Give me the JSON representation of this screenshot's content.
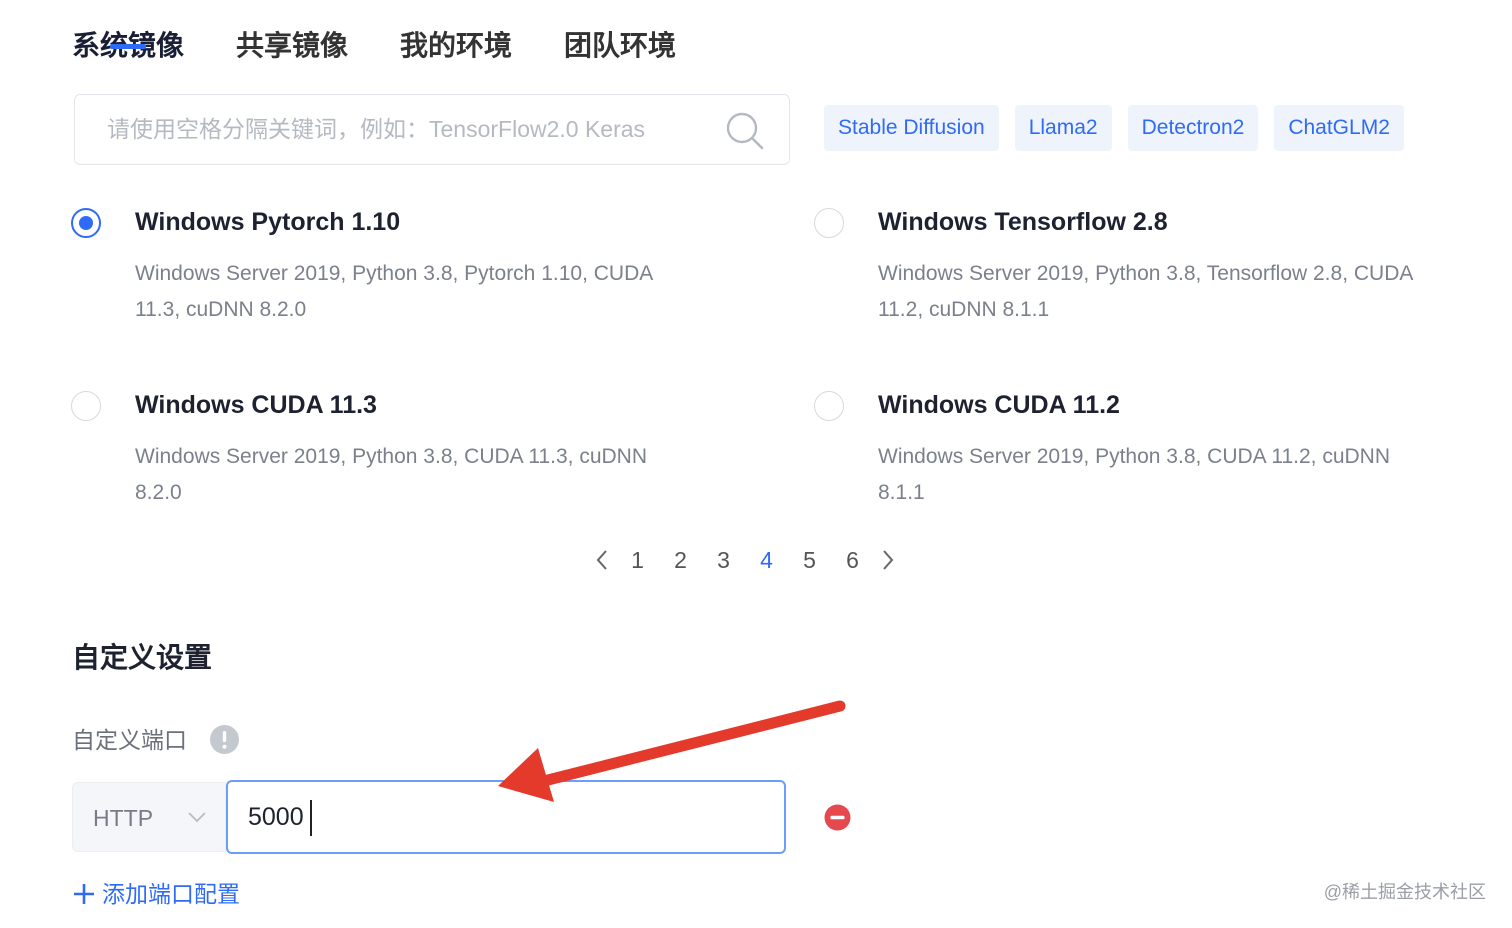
{
  "tabs": [
    {
      "label": "系统镜像",
      "active": true
    },
    {
      "label": "共享镜像",
      "active": false
    },
    {
      "label": "我的环境",
      "active": false
    },
    {
      "label": "团队环境",
      "active": false
    }
  ],
  "search": {
    "placeholder": "请使用空格分隔关键词，例如：TensorFlow2.0 Keras",
    "value": ""
  },
  "quick_tags": [
    "Stable Diffusion",
    "Llama2",
    "Detectron2",
    "ChatGLM2"
  ],
  "images": [
    {
      "title": "Windows Pytorch 1.10",
      "description": "Windows Server 2019, Python 3.8, Pytorch 1.10, CUDA 11.3, cuDNN 8.2.0",
      "selected": true
    },
    {
      "title": "Windows Tensorflow 2.8",
      "description": "Windows Server 2019, Python 3.8, Tensorflow 2.8, CUDA 11.2, cuDNN 8.1.1",
      "selected": false
    },
    {
      "title": "Windows CUDA 11.3",
      "description": "Windows Server 2019, Python 3.8, CUDA 11.3, cuDNN 8.2.0",
      "selected": false
    },
    {
      "title": "Windows CUDA 11.2",
      "description": "Windows Server 2019, Python 3.8, CUDA 11.2, cuDNN 8.1.1",
      "selected": false
    }
  ],
  "pagination": {
    "pages": [
      "1",
      "2",
      "3",
      "4",
      "5",
      "6"
    ],
    "current": "4",
    "prev_icon": "chevron-left-icon",
    "next_icon": "chevron-right-icon"
  },
  "custom_settings": {
    "title": "自定义设置",
    "port_label": "自定义端口",
    "port_info_icon": "info-icon",
    "protocol": "HTTP",
    "port_value": "5000",
    "remove_icon": "remove-icon",
    "add_label": "添加端口配置"
  },
  "colors": {
    "accent": "#2f6bf6",
    "tag_background": "#eef3fc",
    "danger": "#e5484d",
    "annotation_arrow": "#e33a2c"
  },
  "watermark": "@稀土掘金技术社区"
}
